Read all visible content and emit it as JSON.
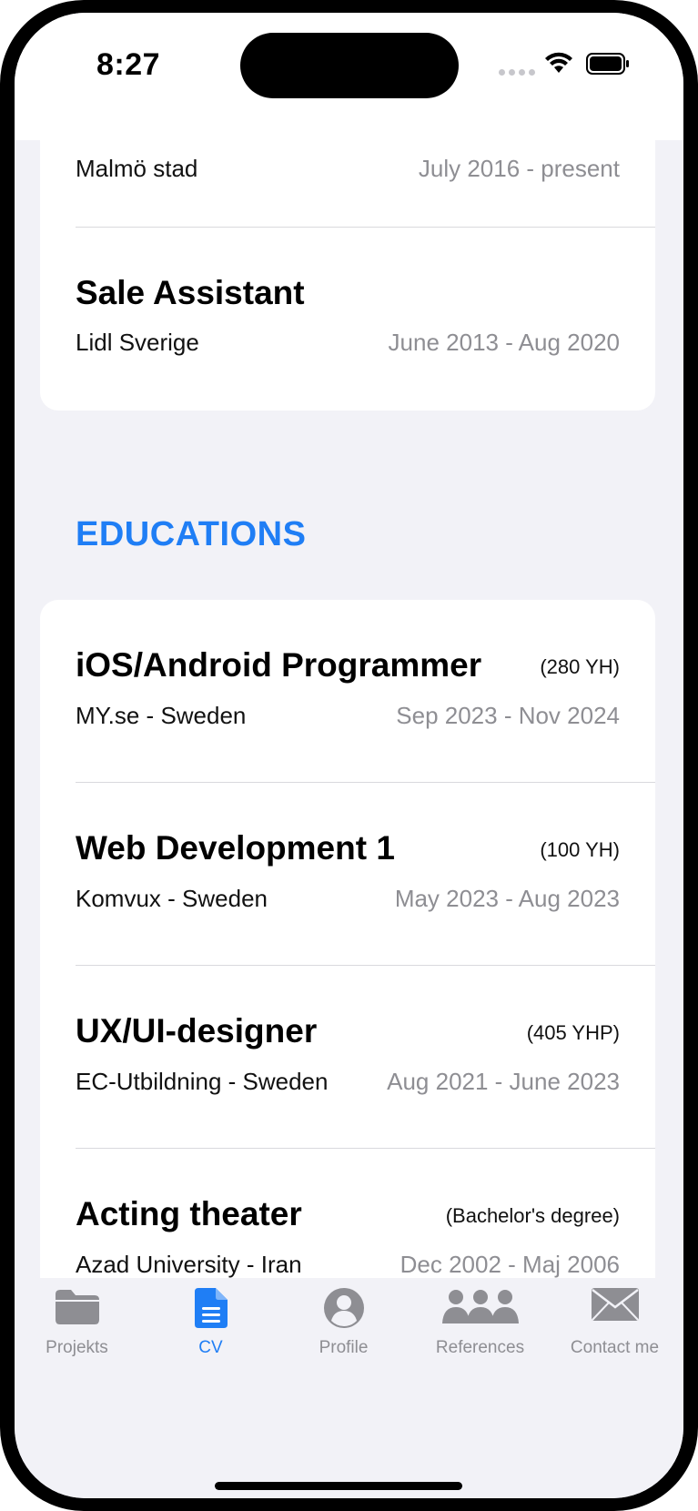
{
  "status_bar": {
    "time": "8:27"
  },
  "work": [
    {
      "company": "Malmö stad",
      "dates": "July 2016 - present"
    },
    {
      "title": "Sale Assistant",
      "company": "Lidl Sverige",
      "dates": "June 2013 - Aug 2020"
    }
  ],
  "educations": {
    "heading": "EDUCATIONS",
    "items": [
      {
        "title": "iOS/Android Programmer",
        "credits": "(280 YH)",
        "school": "MY.se - Sweden",
        "dates": "Sep 2023 - Nov 2024"
      },
      {
        "title": "Web Development 1",
        "credits": "(100 YH)",
        "school": "Komvux - Sweden",
        "dates": "May 2023 - Aug 2023"
      },
      {
        "title": "UX/UI-designer",
        "credits": "(405 YHP)",
        "school": "EC-Utbildning - Sweden",
        "dates": "Aug 2021 - June 2023"
      },
      {
        "title": "Acting theater",
        "credits": "(Bachelor's degree)",
        "school": "Azad University - Iran",
        "dates": "Dec 2002 - Maj 2006"
      }
    ]
  },
  "tab_bar": {
    "active": "CV",
    "tabs": [
      {
        "label": "Projekts",
        "icon": "folder-icon"
      },
      {
        "label": "CV",
        "icon": "document-icon"
      },
      {
        "label": "Profile",
        "icon": "person-circle-icon"
      },
      {
        "label": "References",
        "icon": "people-icon"
      },
      {
        "label": "Contact me",
        "icon": "envelope-icon"
      }
    ]
  },
  "colors": {
    "accent": "#1f7ef5",
    "secondary_text": "#8e8e93",
    "background": "#f2f2f7"
  }
}
